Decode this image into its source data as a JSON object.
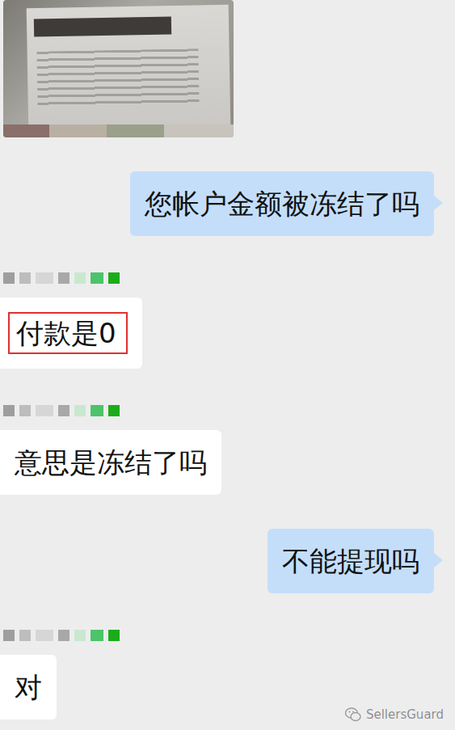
{
  "conversation": {
    "messages": [
      {
        "kind": "image",
        "outgoing": false,
        "name_masked": false
      },
      {
        "kind": "text",
        "outgoing": true,
        "name_masked": false,
        "text": "您帐户金额被冻结了吗",
        "highlighted": false
      },
      {
        "kind": "text",
        "outgoing": false,
        "name_masked": true,
        "text": "付款是0",
        "highlighted": true
      },
      {
        "kind": "text",
        "outgoing": false,
        "name_masked": true,
        "text": "意思是冻结了吗",
        "highlighted": false
      },
      {
        "kind": "text",
        "outgoing": true,
        "name_masked": false,
        "text": "不能提现吗",
        "highlighted": false
      },
      {
        "kind": "text",
        "outgoing": false,
        "name_masked": true,
        "text": "对",
        "highlighted": false
      }
    ]
  },
  "watermark": {
    "text": "SellersGuard"
  }
}
